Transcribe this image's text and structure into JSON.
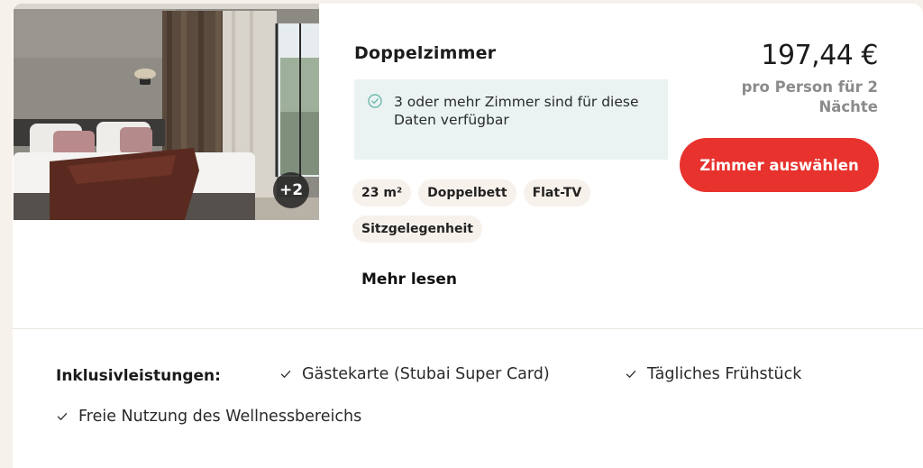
{
  "room": {
    "title": "Doppelzimmer",
    "photo_more_badge": "+2",
    "availability_text": "3 oder mehr Zimmer sind für diese Daten verfügbar",
    "features": [
      "23 m²",
      "Doppelbett",
      "Flat-TV",
      "Sitzgelegenheit"
    ],
    "read_more_label": "Mehr lesen"
  },
  "pricing": {
    "price": "197,44 €",
    "price_note": "pro Person für 2 Nächte",
    "select_button_label": "Zimmer auswählen"
  },
  "inclusions": {
    "label": "Inklusivleistungen:",
    "items": [
      "Gästekarte (Stubai Super Card)",
      "Tägliches Frühstück",
      "Freie Nutzung des Wellnessbereichs"
    ]
  },
  "colors": {
    "accent": "#e8322d",
    "availability_bg": "#eaf3f2",
    "chip_bg": "#f7f1ec",
    "check_icon": "#6fb8ad"
  },
  "icons": {
    "availability": "check-circle-icon",
    "inclusion": "checkmark-icon"
  }
}
